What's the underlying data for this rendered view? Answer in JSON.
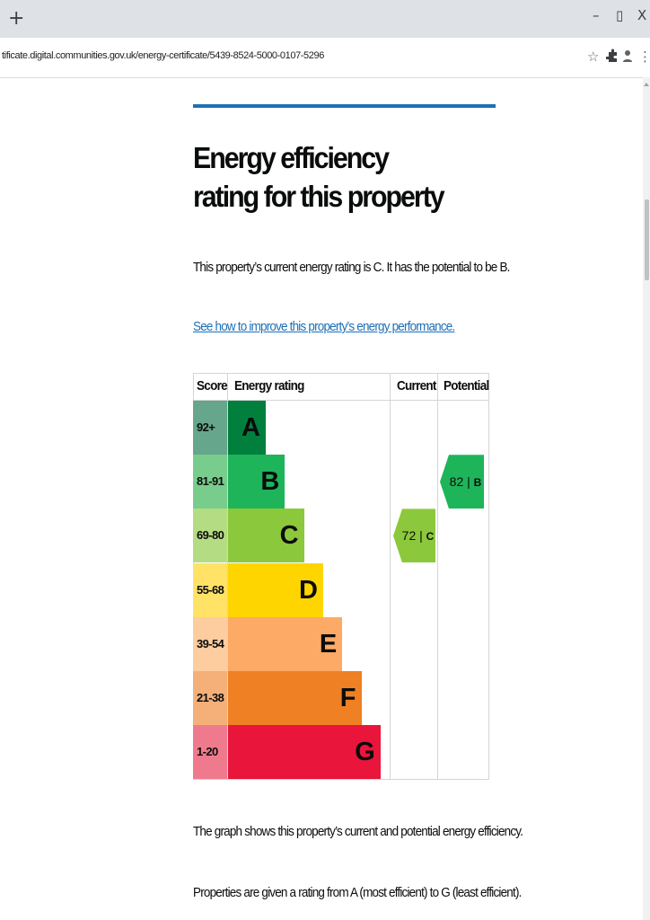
{
  "browser": {
    "new_tab_glyph": "+",
    "window_controls": {
      "minimize": "–",
      "restore": "▯",
      "close": "X"
    },
    "url": "tificate.digital.communities.gov.uk/energy-certificate/5439-8524-5000-0107-5296",
    "toolbar_icons": [
      "star-icon",
      "extension-puzzle-icon",
      "profile-icon",
      "kebab-menu-icon"
    ]
  },
  "page": {
    "title": "Energy efficiency rating for this property",
    "summary": "This property’s current energy rating is C. It has the potential to be B.",
    "improve_link": "See how to improve this property’s energy performance.",
    "graph_note": "The graph shows this property’s current and potential energy efficiency.",
    "ratings_note": "Properties are given a rating from A (most efficient) to G (least efficient)."
  },
  "chart_data": {
    "type": "table",
    "columns": [
      "Score",
      "Energy rating",
      "Current",
      "Potential"
    ],
    "bands": [
      {
        "score": "92+",
        "letter": "A",
        "bar_color": "#007f3d",
        "score_color": "#66a68c"
      },
      {
        "score": "81-91",
        "letter": "B",
        "bar_color": "#1eb45a",
        "score_color": "#78cc8c"
      },
      {
        "score": "69-80",
        "letter": "C",
        "bar_color": "#8cc83c",
        "score_color": "#b4dc82"
      },
      {
        "score": "55-68",
        "letter": "D",
        "bar_color": "#ffd500",
        "score_color": "#ffe266"
      },
      {
        "score": "39-54",
        "letter": "E",
        "bar_color": "#fcaa65",
        "score_color": "#fdcc9f"
      },
      {
        "score": "21-38",
        "letter": "F",
        "bar_color": "#ef8023",
        "score_color": "#f5b07a"
      },
      {
        "score": "1-20",
        "letter": "G",
        "bar_color": "#e9153b",
        "score_color": "#f07a8d"
      }
    ],
    "current": {
      "value": 72,
      "letter": "C",
      "label": "72 | C",
      "color": "#8cc83c"
    },
    "potential": {
      "value": 82,
      "letter": "B",
      "label": "82 | B",
      "color": "#1eb45a"
    }
  }
}
